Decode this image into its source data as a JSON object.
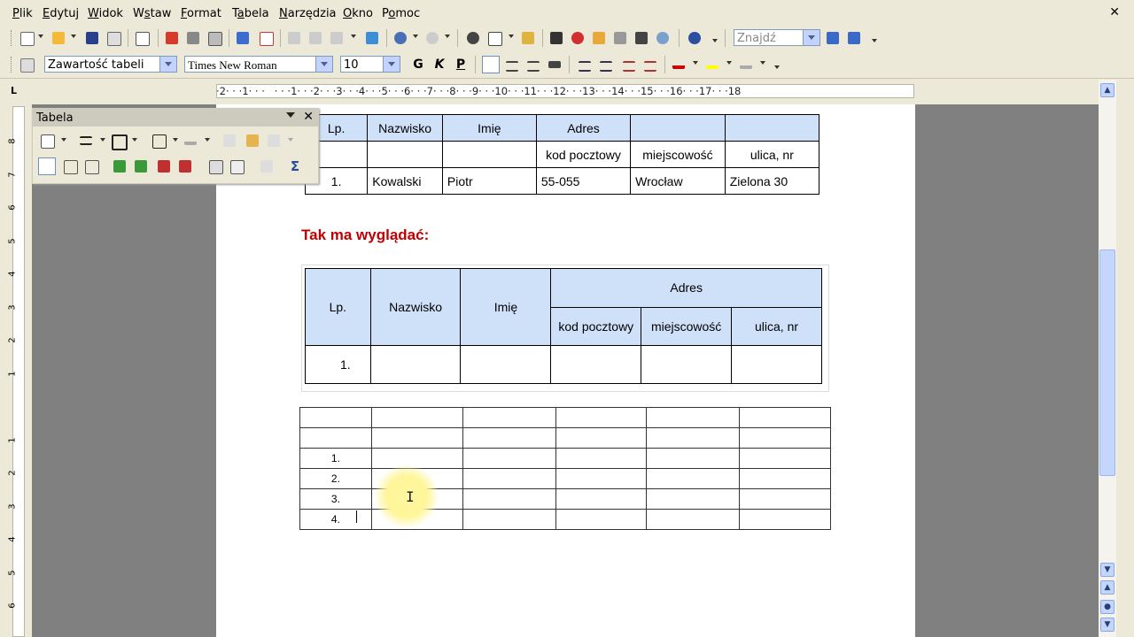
{
  "menu": [
    "Plik",
    "Edytuj",
    "Widok",
    "Wstaw",
    "Format",
    "Tabela",
    "Narzędzia",
    "Okno",
    "Pomoc"
  ],
  "menu_underline": [
    "P",
    "E",
    "W",
    "s",
    "F",
    "a",
    "N",
    "O",
    "o"
  ],
  "close_glyph": "✕",
  "toolbar": {
    "search_placeholder": "Znajdź",
    "style_value": "Zawartość tabeli",
    "font_value": "Times New Roman",
    "size_value": "10",
    "bold": "G",
    "italic": "K",
    "underline": "P"
  },
  "ruler": {
    "text": "·2· · ·1· · ·   · · ·1· · ·2· · ·3· · ·4· · ·5· · ·6· · ·7· · ·8· · ·9· · ·10· · ·11· · ·12· · ·13· · ·14· · ·15· · ·16· · ·17· · ·18",
    "vertical": [
      "8",
      "7",
      "6",
      "5",
      "4",
      "3",
      "2",
      "1",
      "",
      "1",
      "2",
      "3",
      "4",
      "5",
      "6"
    ]
  },
  "panel": {
    "title": "Tabela"
  },
  "table1": {
    "header": [
      "Lp.",
      "Nazwisko",
      "Imię",
      "Adres",
      "",
      ""
    ],
    "subheader": [
      "",
      "",
      "",
      "kod pocztowy",
      "miejscowość",
      "ulica, nr"
    ],
    "row": [
      "1.",
      "Kowalski",
      "Piotr",
      "55-055",
      "Wrocław",
      "Zielona 30"
    ]
  },
  "heading": "Tak ma wyglądać:",
  "table2": {
    "lp": "Lp.",
    "nazwisko": "Nazwisko",
    "imie": "Imię",
    "adres": "Adres",
    "kod": "kod pocztowy",
    "miejscowosc": "miejscowość",
    "ulica": "ulica, nr",
    "row1": "1."
  },
  "table3": {
    "rows": [
      "",
      "",
      "1.",
      "2.",
      "3.",
      "4."
    ]
  }
}
